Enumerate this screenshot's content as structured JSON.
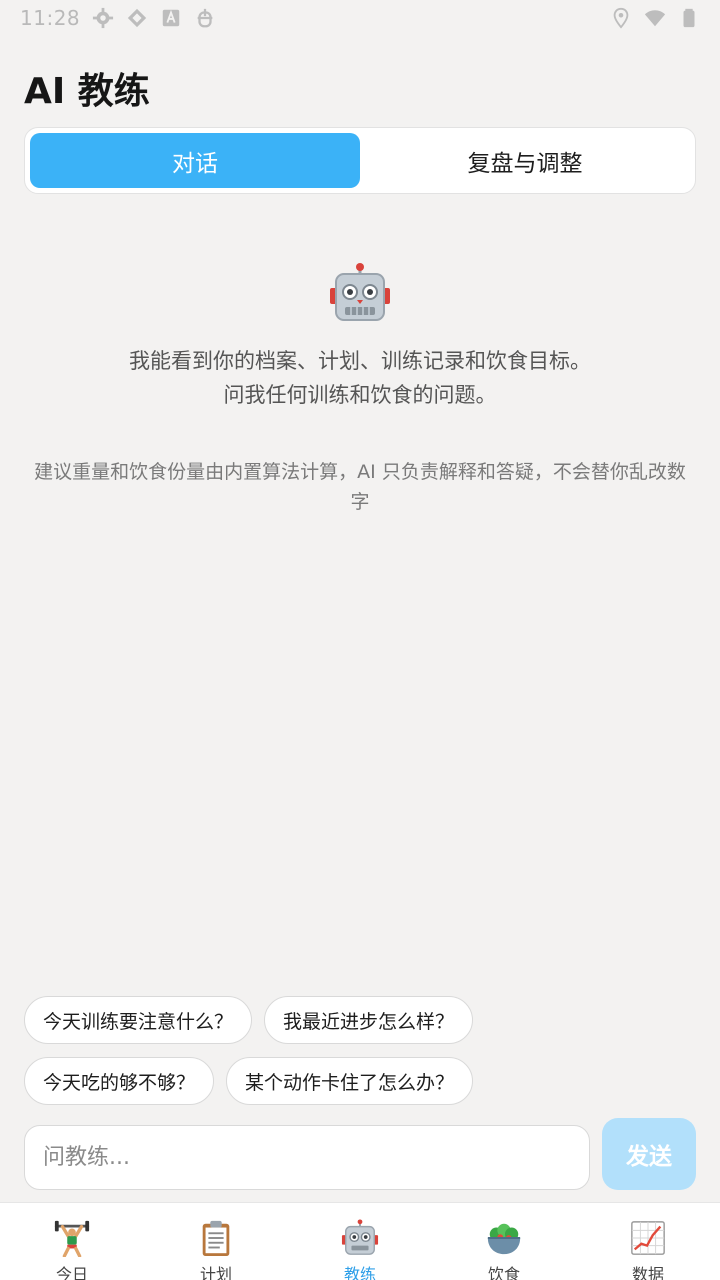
{
  "status_bar": {
    "time": "11:28",
    "icons_left": [
      "gear-icon",
      "sync-icon",
      "font-icon",
      "bug-icon"
    ],
    "icons_right": [
      "location-icon",
      "wifi-icon",
      "battery-icon"
    ]
  },
  "header": {
    "title": "AI 教练"
  },
  "tabs": [
    {
      "label": "对话",
      "active": true
    },
    {
      "label": "复盘与调整",
      "active": false
    }
  ],
  "empty_state": {
    "icon": "robot-icon",
    "line1": "我能看到你的档案、计划、训练记录和饮食目标。",
    "line2": "问我任何训练和饮食的问题。",
    "disclaimer": "建议重量和饮食份量由内置算法计算，AI 只负责解释和答疑，不会替你乱改数字"
  },
  "suggestions": [
    "今天训练要注意什么？",
    "我最近进步怎么样？",
    "今天吃的够不够？",
    "某个动作卡住了怎么办？"
  ],
  "composer": {
    "placeholder": "问教练...",
    "value": "",
    "send_label": "发送"
  },
  "bottom_nav": [
    {
      "label": "今日",
      "icon": "weightlifter-icon",
      "active": false
    },
    {
      "label": "计划",
      "icon": "clipboard-icon",
      "active": false
    },
    {
      "label": "教练",
      "icon": "robot-icon",
      "active": true
    },
    {
      "label": "饮食",
      "icon": "salad-icon",
      "active": false
    },
    {
      "label": "数据",
      "icon": "chart-icon",
      "active": false
    }
  ],
  "colors": {
    "accent": "#3bb2f7",
    "send_disabled": "#b2e0fb",
    "background": "#f3f2f1",
    "active_nav": "#2f9fe8"
  }
}
